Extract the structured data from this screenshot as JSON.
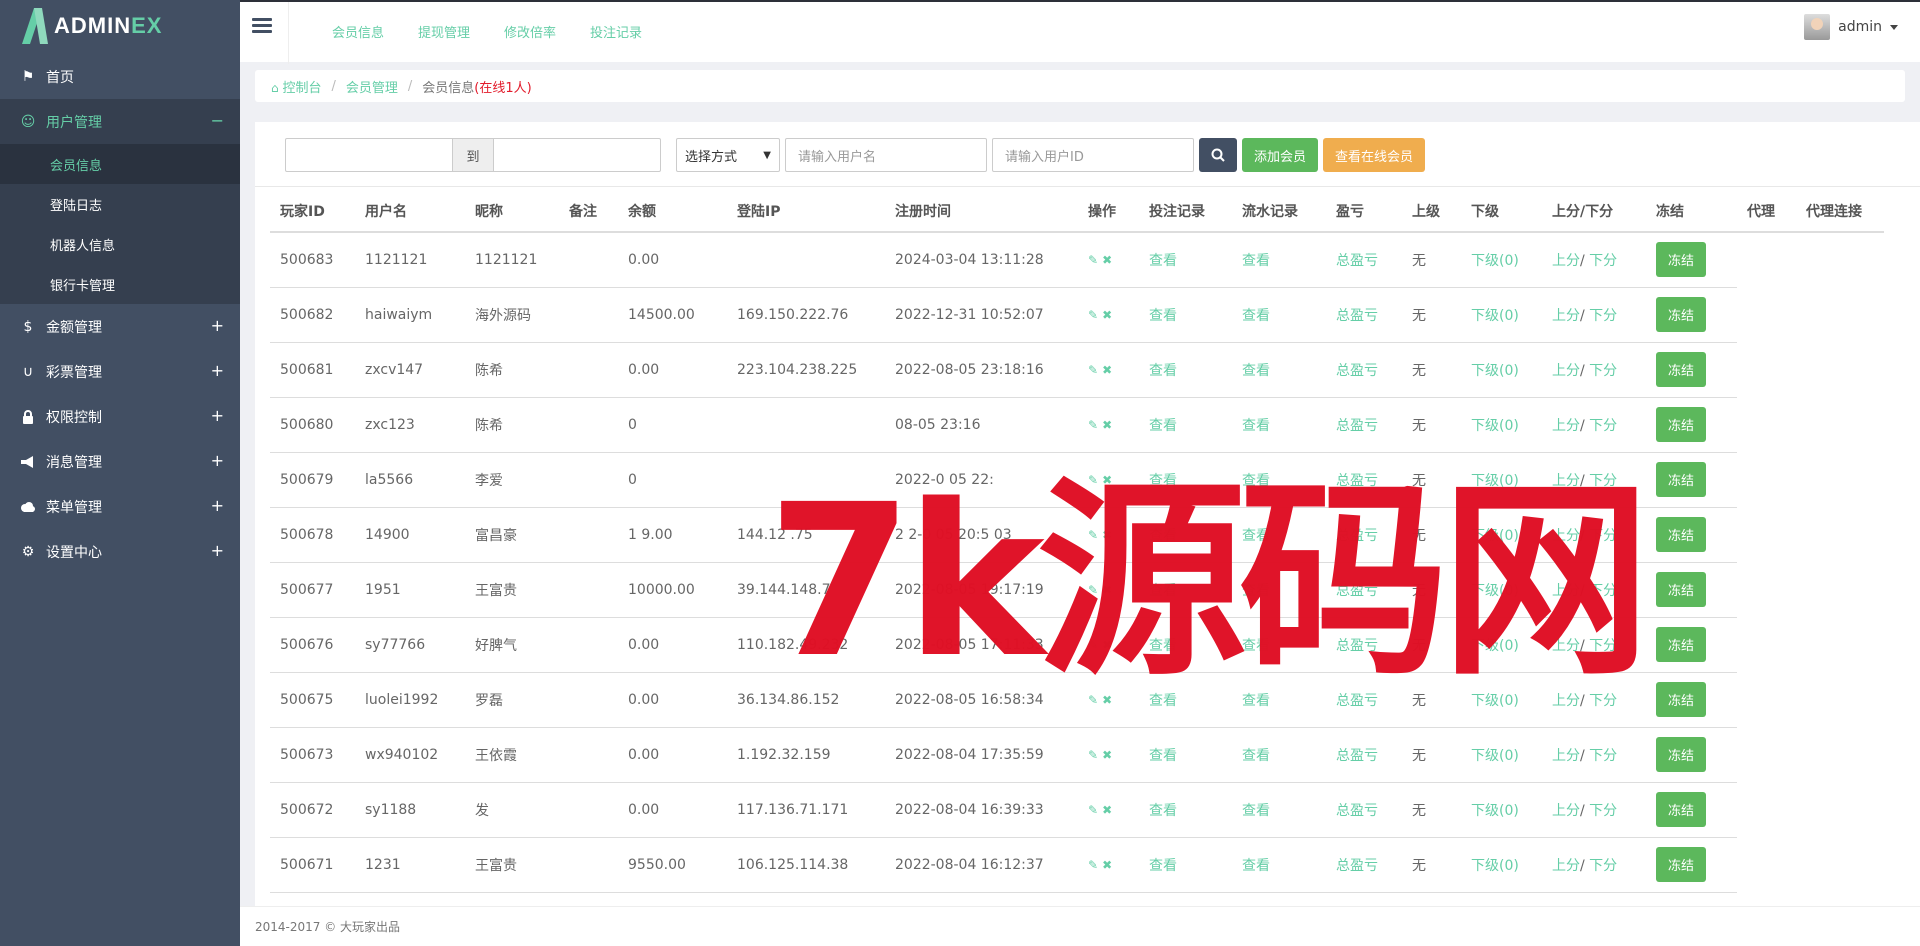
{
  "brand": {
    "logo_main": "ADMIN",
    "logo_accent": "EX"
  },
  "sidebar": {
    "items": [
      {
        "icon": "flag-icon",
        "label": "首页",
        "toggle": ""
      },
      {
        "icon": "user-icon",
        "label": "用户管理",
        "toggle": "−"
      },
      {
        "icon": "dollar-icon",
        "label": "金额管理",
        "toggle": "+"
      },
      {
        "icon": "magnet-icon",
        "label": "彩票管理",
        "toggle": "+"
      },
      {
        "icon": "lock-icon",
        "label": "权限控制",
        "toggle": "+"
      },
      {
        "icon": "bullhorn-icon",
        "label": "消息管理",
        "toggle": "+"
      },
      {
        "icon": "cloud-icon",
        "label": "菜单管理",
        "toggle": "+"
      },
      {
        "icon": "gear-icon",
        "label": "设置中心",
        "toggle": "+"
      }
    ],
    "sub_items": [
      "会员信息",
      "登陆日志",
      "机器人信息",
      "银行卡管理"
    ]
  },
  "header": {
    "nav": [
      "会员信息",
      "提现管理",
      "修改倍率",
      "投注记录"
    ],
    "user_name": "admin"
  },
  "breadcrumb": {
    "home": "控制台",
    "level1": "会员管理",
    "current": "会员信息",
    "online": "(在线1人)"
  },
  "toolbar": {
    "to_label": "到",
    "select_value": "选择方式",
    "username_placeholder": "请输入用户名",
    "userid_placeholder": "请输入用户ID",
    "add_label": "添加会员",
    "online_label": "查看在线会员"
  },
  "table": {
    "headers": [
      "玩家ID",
      "用户名",
      "昵称",
      "备注",
      "余额",
      "登陆IP",
      "注册时间",
      "操作",
      "投注记录",
      "流水记录",
      "盈亏",
      "上级",
      "下级",
      "上分/下分",
      "冻结",
      "代理",
      "代理连接"
    ],
    "rows": [
      {
        "id": "500683",
        "user": "1121121",
        "nick": "1121121",
        "note": "",
        "balance": "0.00",
        "ip": "",
        "time": "2024-03-04 13:11:28"
      },
      {
        "id": "500682",
        "user": "haiwaiym",
        "nick": "海外源码",
        "note": "",
        "balance": "14500.00",
        "ip": "169.150.222.76",
        "time": "2022-12-31 10:52:07"
      },
      {
        "id": "500681",
        "user": "zxcv147",
        "nick": "陈希",
        "note": "",
        "balance": "0.00",
        "ip": "223.104.238.225",
        "time": "2022-08-05 23:18:16"
      },
      {
        "id": "500680",
        "user": "zxc123",
        "nick": "陈希",
        "note": "",
        "balance": "0",
        "ip": "",
        "time": "08-05 23:16"
      },
      {
        "id": "500679",
        "user": "la5566",
        "nick": "李爱",
        "note": "",
        "balance": "0",
        "ip": "",
        "time": "2022-0 05 22:"
      },
      {
        "id": "500678",
        "user": "14900",
        "nick": "富昌豪",
        "note": "",
        "balance": "1 9.00",
        "ip": "144.12 .75",
        "time": "2 2-0 05 20:5 03"
      },
      {
        "id": "500677",
        "user": "1951",
        "nick": "王富贵",
        "note": "",
        "balance": "10000.00",
        "ip": "39.144.148.7",
        "time": "2022-08-05 19:17:19"
      },
      {
        "id": "500676",
        "user": "sy77766",
        "nick": "好脾气",
        "note": "",
        "balance": "0.00",
        "ip": "110.182.49.232",
        "time": "2022-08-05 17:11:33"
      },
      {
        "id": "500675",
        "user": "luolei1992",
        "nick": "罗磊",
        "note": "",
        "balance": "0.00",
        "ip": "36.134.86.152",
        "time": "2022-08-05 16:58:34"
      },
      {
        "id": "500673",
        "user": "wx940102",
        "nick": "王依霞",
        "note": "",
        "balance": "0.00",
        "ip": "1.192.32.159",
        "time": "2022-08-04 17:35:59"
      },
      {
        "id": "500672",
        "user": "sy1188",
        "nick": "发",
        "note": "",
        "balance": "0.00",
        "ip": "117.136.71.171",
        "time": "2022-08-04 16:39:33"
      },
      {
        "id": "500671",
        "user": "1231",
        "nick": "王富贵",
        "note": "",
        "balance": "9550.00",
        "ip": "106.125.114.38",
        "time": "2022-08-04 16:12:37"
      }
    ],
    "bet_link": "查看",
    "flow_link": "查看",
    "pnl_link": "总盈亏",
    "superior": "无",
    "sub_link": "下级(0)",
    "up_link": "上分",
    "slash": "/",
    "down_link": "下分",
    "freeze_label": "冻结"
  },
  "watermark": "7k源码网",
  "footer": "2014-2017 © 大玩家出品"
}
